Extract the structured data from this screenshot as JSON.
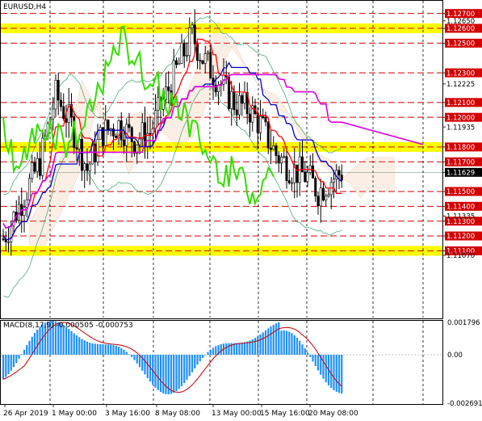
{
  "window": {
    "symbol_label": "EURUSD,H4",
    "macd_label": "MACD(8,17,9) -0.000505 -0.000753"
  },
  "colors": {
    "background": "#ffffff",
    "candles": "#000000",
    "level_line": "#d40000",
    "zone_fill": "#ffff00",
    "tenkan": "#ff0000",
    "kijun": "#0000c8",
    "chikou": "#33dd00",
    "ichimoku_cloud": "#e8a070",
    "bands": "#34a36a",
    "magenta_line": "#dd00dd",
    "macd_hist": "#1e90ff",
    "macd_signal": "#c00000",
    "price_label_bg": "#d40000",
    "current_price_bg": "#000000"
  },
  "price_axis": {
    "max": 1.1278,
    "min": 1.1065,
    "levels_boxed": [
      "1.12700",
      "1.12600",
      "1.12500",
      "1.12300",
      "1.12100",
      "1.12000",
      "1.11800",
      "1.11700",
      "1.11500",
      "1.11400",
      "1.11300",
      "1.11200",
      "1.11100"
    ],
    "levels_plain": [
      "1.12650",
      "1.12225",
      "1.11935",
      "1.11335",
      "1.11070"
    ],
    "current_price": "1.11629"
  },
  "macd_axis": {
    "labels": [
      "0.001796",
      "0.00",
      "-0.002691"
    ]
  },
  "time_axis": {
    "labels": [
      "26 Apr 2019",
      "1 May 00:00",
      "3 May 16:00",
      "8 May 08:00",
      "13 May 00:00",
      "15 May 16:00",
      "20 May 08:00"
    ]
  },
  "yellow_zones": [
    "1.12600",
    "1.11800",
    "1.11100"
  ],
  "chart_data": {
    "type": "candlestick",
    "symbol": "EURUSD",
    "timeframe": "H4",
    "indicators": [
      "Ichimoku",
      "Envelope/Bands",
      "MACD(8,17,9)"
    ],
    "price_range": [
      1.1065,
      1.1278
    ],
    "support_resistance_levels": [
      1.127,
      1.126,
      1.125,
      1.123,
      1.121,
      1.12,
      1.118,
      1.117,
      1.115,
      1.114,
      1.113,
      1.112,
      1.111
    ],
    "current_price": 1.11629,
    "macd": {
      "main": -0.000505,
      "signal": -0.000753,
      "range": [
        -0.002691,
        0.001796
      ]
    }
  }
}
